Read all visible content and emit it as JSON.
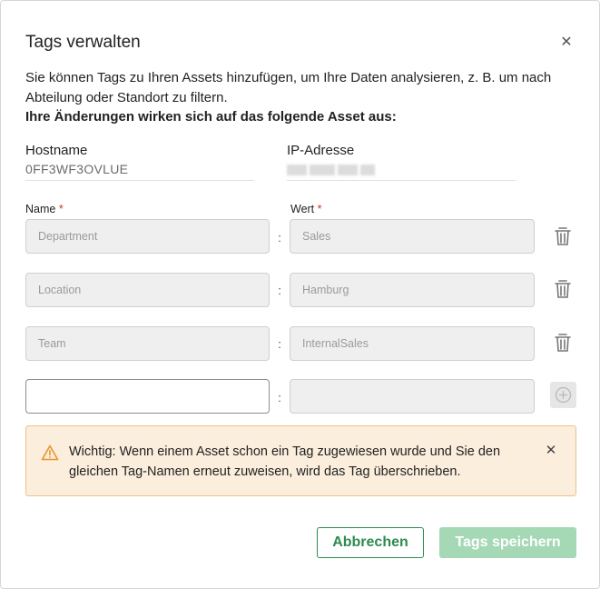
{
  "dialog": {
    "title": "Tags verwalten",
    "close_icon": "close-icon",
    "intro_text": "Sie können Tags zu Ihren Assets hinzufügen, um Ihre Daten analysieren, z. B. um nach Abteilung oder Standort zu filtern.",
    "intro_bold": "Ihre Änderungen wirken sich auf das folgende Asset aus:"
  },
  "asset": {
    "hostname_label": "Hostname",
    "hostname_value": "0FF3WF3OVLUE",
    "ip_label": "IP-Adresse"
  },
  "tags": {
    "name_label": "Name",
    "value_label": "Wert",
    "required_mark": "*",
    "separator": ":",
    "rows": [
      {
        "name": "Department",
        "value": "Sales"
      },
      {
        "name": "Location",
        "value": "Hamburg"
      },
      {
        "name": "Team",
        "value": "InternalSales"
      }
    ],
    "new_row": {
      "name": "",
      "value": ""
    }
  },
  "warning": {
    "text": "Wichtig: Wenn einem Asset schon ein Tag zugewiesen wurde und Sie den gleichen Tag-Namen erneut zuweisen, wird das Tag überschrieben.",
    "icon": "warning-icon"
  },
  "actions": {
    "cancel_label": "Abbrechen",
    "save_label": "Tags speichern"
  },
  "colors": {
    "primary_green": "#2e8b4f",
    "disabled_green": "#a5d8b4",
    "warning_bg": "#fbeedc",
    "warning_border": "#e9c48e",
    "required_red": "#d0342c"
  }
}
